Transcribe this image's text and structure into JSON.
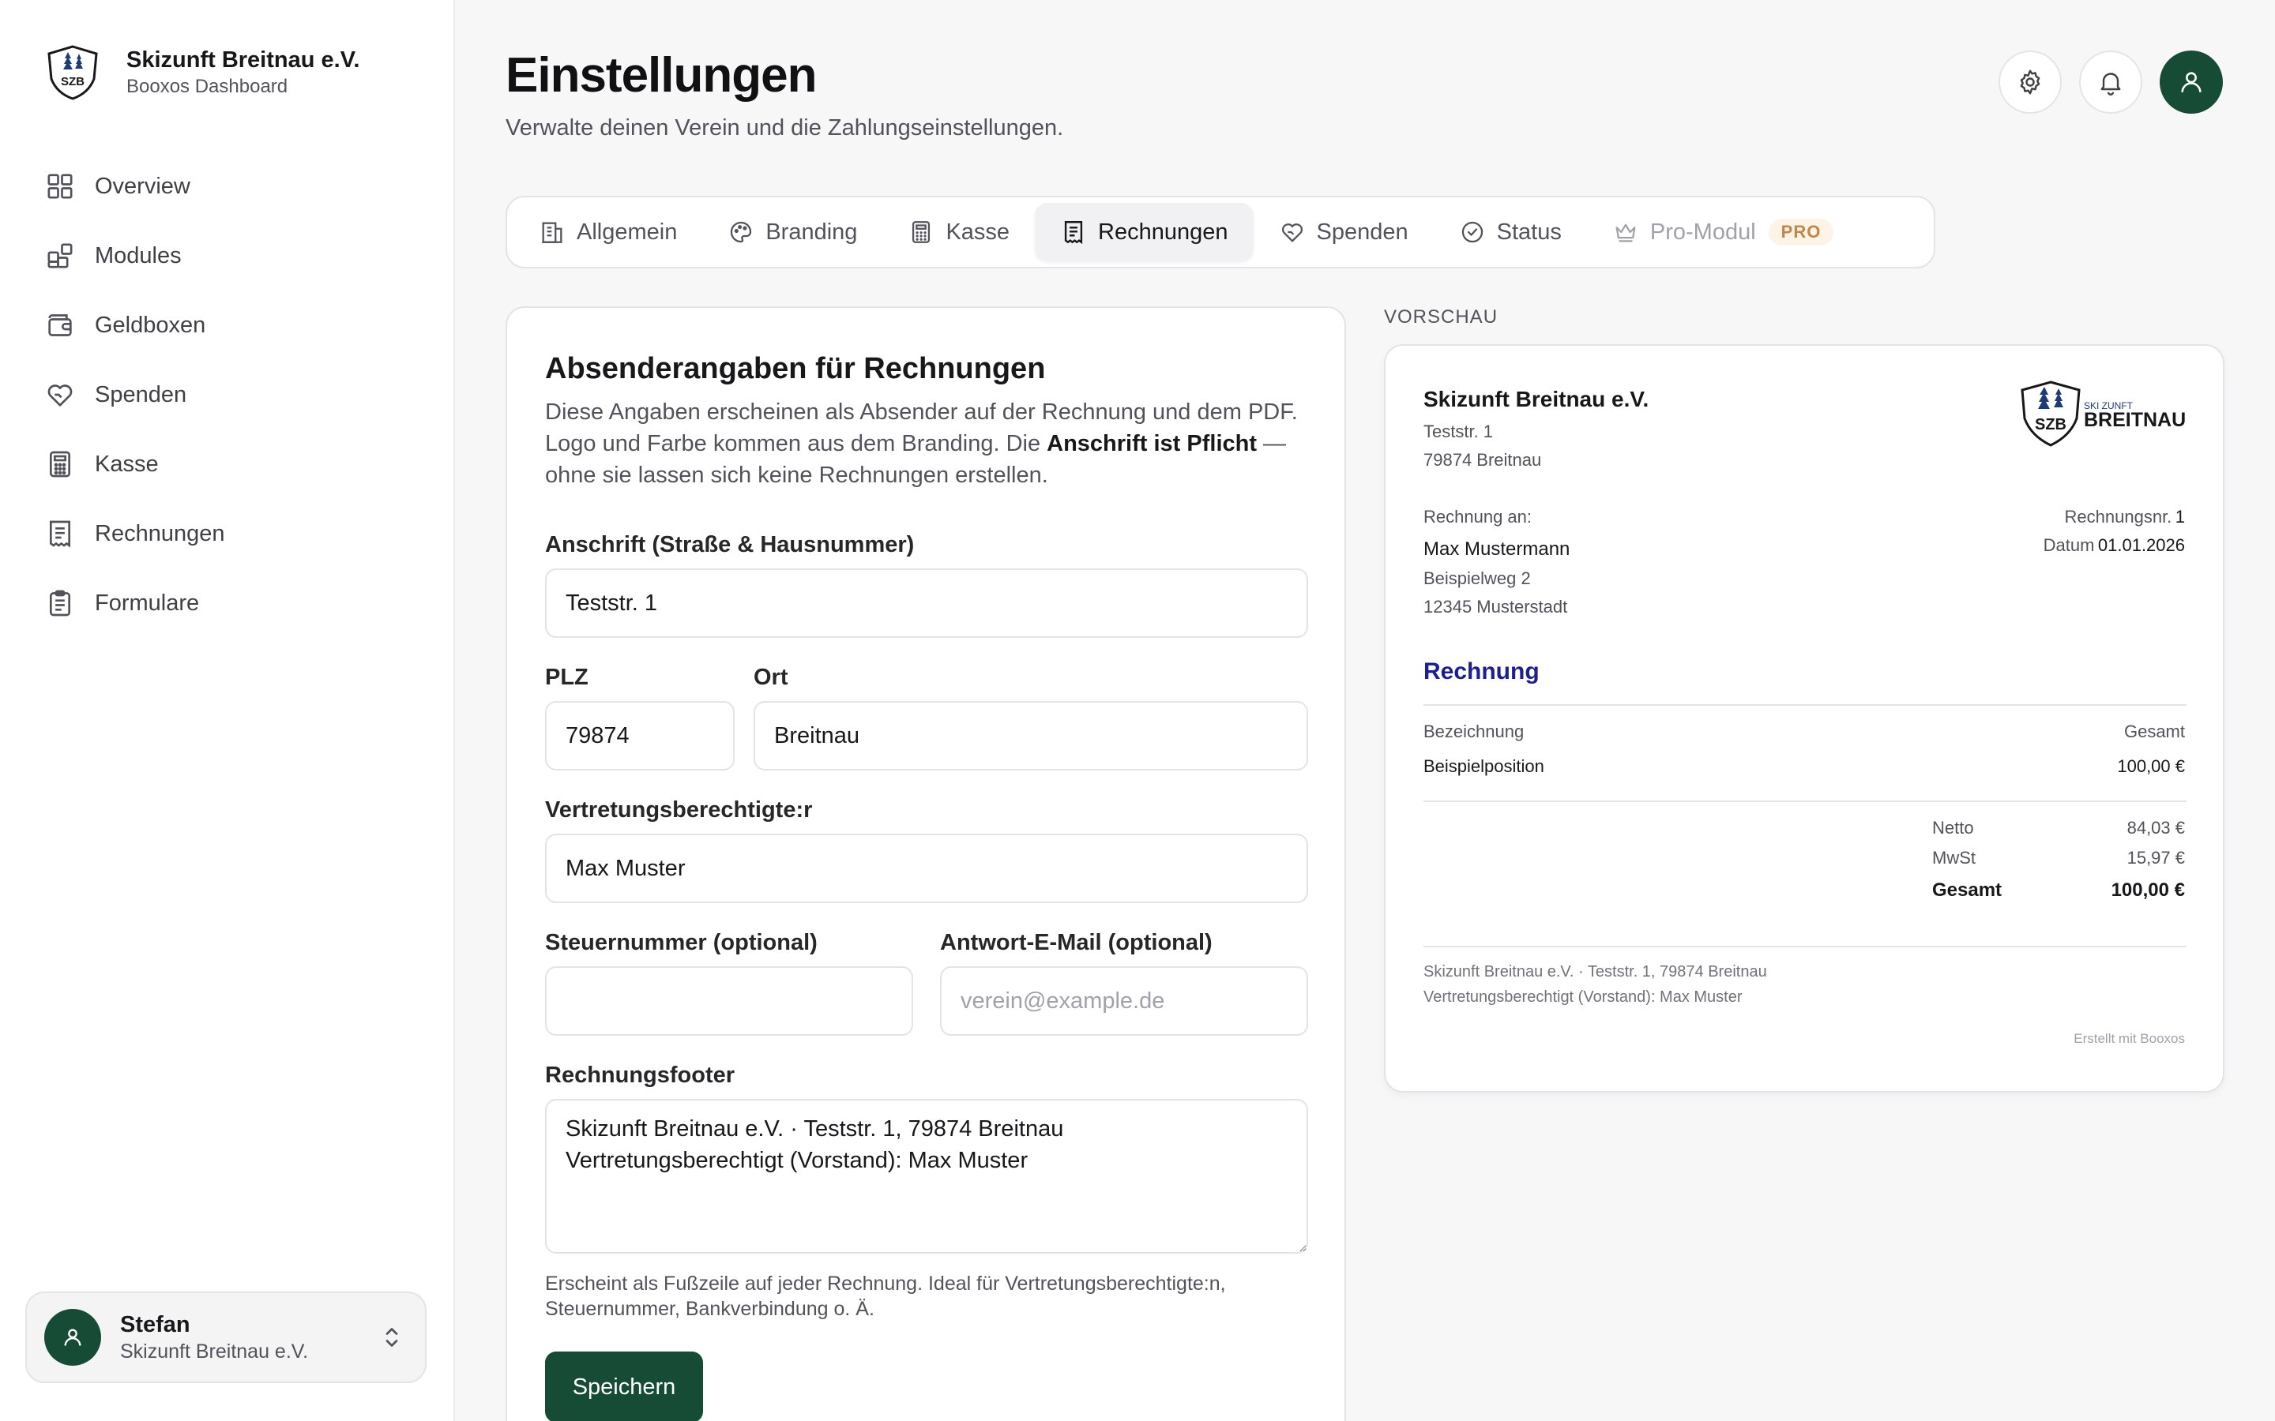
{
  "sidebar": {
    "org_name": "Skizunft Breitnau e.V.",
    "org_sub": "Booxos Dashboard",
    "logo_text": "SZB",
    "items": [
      {
        "label": "Overview",
        "icon": "grid-icon"
      },
      {
        "label": "Modules",
        "icon": "modules-icon"
      },
      {
        "label": "Geldboxen",
        "icon": "wallet-icon"
      },
      {
        "label": "Spenden",
        "icon": "heart-hand-icon"
      },
      {
        "label": "Kasse",
        "icon": "calculator-icon"
      },
      {
        "label": "Rechnungen",
        "icon": "receipt-icon"
      },
      {
        "label": "Formulare",
        "icon": "clipboard-icon"
      }
    ],
    "user": {
      "name": "Stefan",
      "org": "Skizunft Breitnau e.V."
    }
  },
  "header": {
    "title": "Einstellungen",
    "subtitle": "Verwalte deinen Verein und die Zahlungseinstellungen."
  },
  "tabs": [
    {
      "label": "Allgemein",
      "icon": "building-icon"
    },
    {
      "label": "Branding",
      "icon": "palette-icon"
    },
    {
      "label": "Kasse",
      "icon": "calculator-icon"
    },
    {
      "label": "Rechnungen",
      "icon": "receipt-icon",
      "active": true
    },
    {
      "label": "Spenden",
      "icon": "heart-hand-icon"
    },
    {
      "label": "Status",
      "icon": "check-circle-icon"
    },
    {
      "label": "Pro-Modul",
      "icon": "crown-icon",
      "badge": "PRO",
      "disabled": true
    }
  ],
  "form": {
    "title": "Absenderangaben für Rechnungen",
    "desc_part1": "Diese Angaben erscheinen als Absender auf der Rechnung und dem PDF. Logo und Farbe kommen aus dem Branding. Die ",
    "desc_bold": "Anschrift ist Pflicht",
    "desc_part2": " — ohne sie lassen sich keine Rechnungen erstellen.",
    "address_label": "Anschrift (Straße & Hausnummer)",
    "address_value": "Teststr. 1",
    "plz_label": "PLZ",
    "plz_value": "79874",
    "ort_label": "Ort",
    "ort_value": "Breitnau",
    "rep_label": "Vertretungsberechtigte:r",
    "rep_value": "Max Muster",
    "tax_label": "Steuernummer (optional)",
    "tax_value": "",
    "email_label": "Antwort-E-Mail (optional)",
    "email_placeholder": "verein@example.de",
    "footer_label": "Rechnungsfooter",
    "footer_value": "Skizunft Breitnau e.V. · Teststr. 1, 79874 Breitnau\nVertretungsberechtigt (Vorstand): Max Muster",
    "footer_hint": "Erscheint als Fußzeile auf jeder Rechnung. Ideal für Vertretungsberechtigte:n, Steuernummer, Bankverbindung o. Ä.",
    "save_label": "Speichern"
  },
  "preview": {
    "label": "VORSCHAU",
    "org_name": "Skizunft Breitnau e.V.",
    "org_street": "Teststr. 1",
    "org_city": "79874 Breitnau",
    "logo_small": "SKI ZUNFT",
    "logo_big": "BREITNAU",
    "bill_to_label": "Rechnung an:",
    "customer_name": "Max Mustermann",
    "customer_street": "Beispielweg 2",
    "customer_city": "12345 Musterstadt",
    "invoice_no_label": "Rechnungsnr.",
    "invoice_no": "1",
    "date_label": "Datum",
    "date": "01.01.2026",
    "invoice_title": "Rechnung",
    "col_desc": "Bezeichnung",
    "col_total": "Gesamt",
    "item_name": "Beispielposition",
    "item_total": "100,00 €",
    "netto_label": "Netto",
    "netto": "84,03 €",
    "mwst_label": "MwSt",
    "mwst": "15,97 €",
    "gesamt_label": "Gesamt",
    "gesamt": "100,00 €",
    "footer_line1": "Skizunft Breitnau e.V. · Teststr. 1, 79874 Breitnau",
    "footer_line2": "Vertretungsberechtigt (Vorstand): Max Muster",
    "made_with": "Erstellt mit Booxos"
  },
  "colors": {
    "accent": "#164b35",
    "invoice_title": "#1e1e8f",
    "pro_badge_bg": "#fdf3e7",
    "pro_badge_text": "#c2864a"
  }
}
